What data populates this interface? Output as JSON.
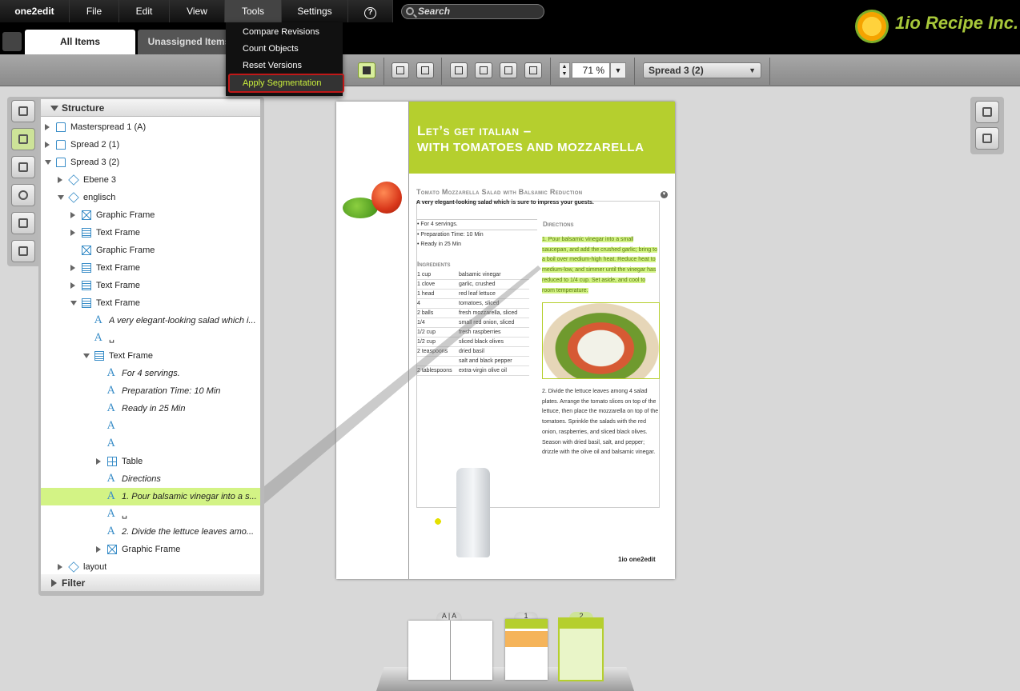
{
  "menubar": {
    "items": [
      "one2edit",
      "File",
      "Edit",
      "View",
      "Tools",
      "Settings"
    ],
    "help_label": "?",
    "search_placeholder": "Search"
  },
  "logo": {
    "text": "1io Recipe Inc."
  },
  "tabs": {
    "all_items": "All Items",
    "unassigned_items": "Unassigned Items"
  },
  "tools_menu": {
    "items": [
      "Compare Revisions",
      "Count Objects",
      "Reset Versions",
      "Apply Segmentation"
    ],
    "highlighted": "Apply Segmentation"
  },
  "toolbar": {
    "zoom": "71 %",
    "spread_select": "Spread 3 (2)"
  },
  "structure": {
    "header": "Structure",
    "filter_header": "Filter",
    "rows": [
      {
        "label": "Masterspread 1 (A)",
        "icon": "spread-icon",
        "depth": 0,
        "toggle": "closed"
      },
      {
        "label": "Spread 2 (1)",
        "icon": "spread-icon",
        "depth": 0,
        "toggle": "closed"
      },
      {
        "label": "Spread 3 (2)",
        "icon": "spread-icon",
        "depth": 0,
        "toggle": "open"
      },
      {
        "label": "Ebene 3",
        "icon": "layer-icon",
        "depth": 1,
        "toggle": "closed"
      },
      {
        "label": "englisch",
        "icon": "layer-icon",
        "depth": 1,
        "toggle": "open"
      },
      {
        "label": "Graphic Frame",
        "icon": "graphic-frame-icon",
        "depth": 2,
        "toggle": "closed"
      },
      {
        "label": "Text Frame",
        "icon": "text-frame-icon",
        "depth": 2,
        "toggle": "closed"
      },
      {
        "label": "Graphic Frame",
        "icon": "graphic-frame-icon",
        "depth": 2,
        "toggle": "none"
      },
      {
        "label": "Text Frame",
        "icon": "text-frame-icon",
        "depth": 2,
        "toggle": "closed"
      },
      {
        "label": "Text Frame",
        "icon": "text-frame-icon",
        "depth": 2,
        "toggle": "closed"
      },
      {
        "label": "Text Frame",
        "icon": "text-frame-icon",
        "depth": 2,
        "toggle": "open"
      },
      {
        "label": "A very elegant-looking salad which i...",
        "icon": "text-story-icon",
        "depth": 3,
        "toggle": "none",
        "italic": true
      },
      {
        "label": "␣",
        "icon": "text-story-icon",
        "depth": 3,
        "toggle": "none"
      },
      {
        "label": "Text Frame",
        "icon": "text-frame-icon",
        "depth": 3,
        "toggle": "open"
      },
      {
        "label": "For 4 servings.",
        "icon": "text-story-icon",
        "depth": 4,
        "toggle": "none",
        "italic": true
      },
      {
        "label": "Preparation Time: 10 Min",
        "icon": "text-story-icon",
        "depth": 4,
        "toggle": "none",
        "italic": true
      },
      {
        "label": "Ready in 25 Min",
        "icon": "text-story-icon",
        "depth": 4,
        "toggle": "none",
        "italic": true
      },
      {
        "label": "",
        "icon": "text-story-icon",
        "depth": 4,
        "toggle": "none"
      },
      {
        "label": "",
        "icon": "text-story-icon",
        "depth": 4,
        "toggle": "none"
      },
      {
        "label": "Table",
        "icon": "table-icon",
        "depth": 4,
        "toggle": "closed"
      },
      {
        "label": "Directions",
        "icon": "text-story-icon",
        "depth": 4,
        "toggle": "none",
        "italic": true
      },
      {
        "label": "1. Pour balsamic vinegar into a s...",
        "icon": "text-story-icon",
        "depth": 4,
        "toggle": "none",
        "italic": true,
        "selected": true
      },
      {
        "label": "␣",
        "icon": "text-story-icon",
        "depth": 4,
        "toggle": "none"
      },
      {
        "label": "2. Divide the lettuce leaves amo...",
        "icon": "text-story-icon",
        "depth": 4,
        "toggle": "none",
        "italic": true
      },
      {
        "label": "Graphic Frame",
        "icon": "graphic-frame-icon",
        "depth": 4,
        "toggle": "closed"
      },
      {
        "label": "layout",
        "icon": "layer-icon",
        "depth": 1,
        "toggle": "closed"
      }
    ]
  },
  "page": {
    "heading_1": "Let’s get italian –",
    "heading_2": "with tomatoes and mozzarella",
    "recipe_title": "Tomato Mozzarella Salad with Balsamic Reduction",
    "recipe_sub": "A very elegant-looking salad which is sure to impress your guests.",
    "meta": [
      "• For 4 servings.",
      "• Preparation Time: 10 Min",
      "• Ready in 25 Min"
    ],
    "ingredients_title": "Ingredients",
    "ingredients": [
      [
        "1 cup",
        "balsamic vinegar"
      ],
      [
        "1 clove",
        "garlic, crushed"
      ],
      [
        "1 head",
        "red leaf lettuce"
      ],
      [
        "4",
        "tomatoes, sliced"
      ],
      [
        "2 balls",
        "fresh mozzarella, sliced"
      ],
      [
        "1/4",
        "small red onion, sliced"
      ],
      [
        "1/2 cup",
        "fresh raspberries"
      ],
      [
        "1/2 cup",
        "sliced black olives"
      ],
      [
        "2 teaspoons",
        "dried basil"
      ],
      [
        "",
        "salt and black pepper"
      ],
      [
        "2 tablespoons",
        "extra-virgin olive oil"
      ]
    ],
    "directions_title": "Directions",
    "direction_1": "1. Pour balsamic vinegar into a small saucepan, and add the crushed garlic; bring to a boil over medium-high heat. Reduce heat to medium-low, and simmer until the vinegar has reduced to 1/4 cup. Set aside, and cool to room temperature.",
    "direction_2": "2. Divide the lettuce leaves among 4 salad plates. Arrange the tomato slices on top of the lettuce, then place the mozzarella on top of the tomatoes. Sprinkle the salads with the red onion, raspberries, and sliced black olives. Season with dried basil, salt, and pepper; drizzle with the olive oil and balsamic vinegar.",
    "logo": "1io one2edit"
  },
  "thumbnails": [
    "A | A",
    "1",
    "2"
  ]
}
